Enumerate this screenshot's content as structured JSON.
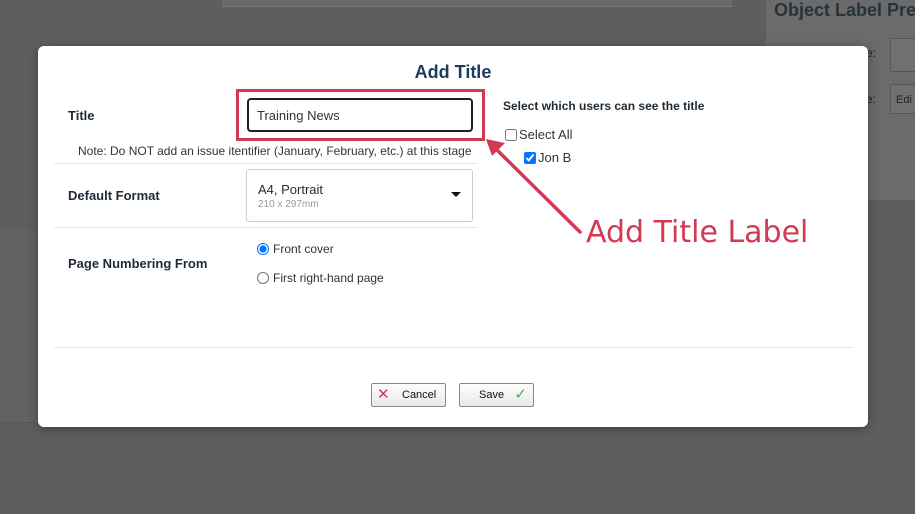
{
  "background": {
    "right_panel_title": "Object Label Prefi",
    "right_label_1": "e:",
    "right_label_2": "e:",
    "right_box_value": "Edi"
  },
  "modal": {
    "title": "Add Title",
    "title_label": "Title",
    "title_value": "Training News",
    "note": "Note: Do NOT add an issue itentifier (January, February, etc.) at this stage",
    "format_label": "Default Format",
    "format_selected": "A4, Portrait",
    "format_selected_sub": "210 x 297mm",
    "numbering_label": "Page Numbering From",
    "numbering_options": [
      "Front cover",
      "First right-hand page"
    ],
    "numbering_selected_index": 0,
    "users_title": "Select which users can see the title",
    "select_all_label": "Select All",
    "select_all_checked": false,
    "users": [
      {
        "name": "Jon B",
        "checked": true
      }
    ],
    "cancel_label": "Cancel",
    "save_label": "Save"
  },
  "annotation": {
    "text": "Add Title Label",
    "color": "#d23a54"
  },
  "icons": {
    "cancel": "close-x-icon",
    "save": "check-icon",
    "format": "chevron-down-icon"
  }
}
